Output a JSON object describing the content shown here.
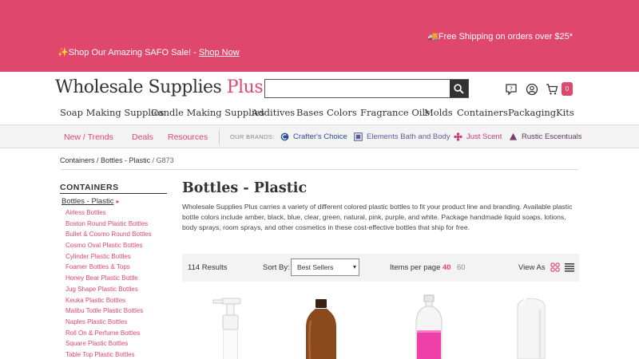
{
  "promo": {
    "free_shipping": "🚚Free Shipping on orders over $25*",
    "sale_text": "✨Shop Our Amazing SAFO Sale! - ",
    "sale_link": "Shop Now",
    "bg_color": "#e0476d"
  },
  "header": {
    "logo_main": "Wholesale Supplies ",
    "logo_accent": "Plus",
    "search_placeholder": "",
    "cart_count": "0",
    "icons": [
      "chat-icon",
      "account-icon",
      "cart-icon"
    ]
  },
  "nav": {
    "items": [
      "Soap Making Supplies",
      "Candle Making Supplies",
      "Additives",
      "Bases",
      "Colors",
      "Fragrance Oils",
      "Molds",
      "Containers",
      "Packaging",
      "Kits"
    ],
    "active": "Containers"
  },
  "subnav": {
    "links": [
      "New / Trends",
      "Deals",
      "Resources"
    ],
    "brands_label": "OUR BRANDS:",
    "brands": [
      "Crafter's Choice",
      "Elements Bath and Body",
      "Just Scent",
      "Rustic Escentuals"
    ]
  },
  "breadcrumb": {
    "first": "Containers",
    "sep": " / ",
    "second": "Bottles - Plastic",
    "code": " / G873"
  },
  "sidebar": {
    "title": "CONTAINERS",
    "active": "Bottles - Plastic",
    "items": [
      "Airless Bottles",
      "Boston Round Plastic Bottles",
      "Bullet & Cosmo Round Bottles",
      "Cosmo Oval Plastic Bottles",
      "Cylinder Plastic Bottles",
      "Foamer Bottles & Tops",
      "Honey Bear Plastic Bottle",
      "Jug Shape Plastic Bottles",
      "Keuka Plastic Bottles",
      "Malibu Tottle Plastic Bottles",
      "Naples Plastic Bottles",
      "Roll On & Perfume Bottles",
      "Square Plastic Bottles",
      "Table Top Plastic Bottles"
    ]
  },
  "main": {
    "title": "Bottles - Plastic",
    "description": "Wholesale Supplies Plus carries a variety of different colored plastic bottles to fit your product line and branding. Available plastic bottle colors include amber, black, blue, clear, green, natural, pink, purple, and white. Package handmade liquid soaps, lotions, body sprays, room sprays, and other cosmetics in these cost-effective bottles that ship for free."
  },
  "toolbar": {
    "results": "114 Results",
    "sort_label": "Sort By:",
    "sort_value": "Best Sellers",
    "per_page_label": "Items per page",
    "per_page_options": [
      "40",
      "60"
    ],
    "per_page_selected": "40",
    "view_label": "View As"
  },
  "products": [
    {
      "image": "white-foamer-pump-bottle"
    },
    {
      "image": "amber-plastic-bottle"
    },
    {
      "image": "clear-bottle-pink-liquid"
    },
    {
      "image": "white-bullet-bottle"
    }
  ]
}
